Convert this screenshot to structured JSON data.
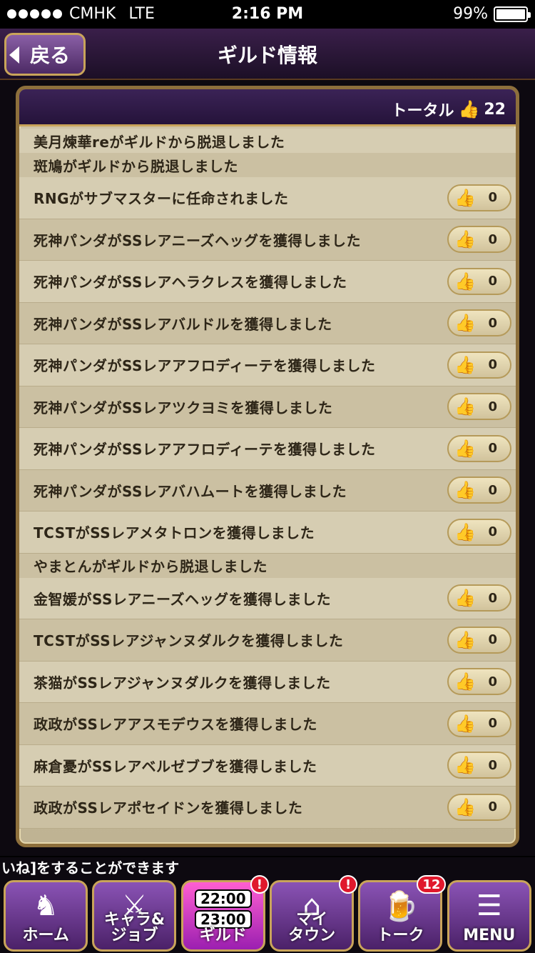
{
  "status_bar": {
    "carrier": "CMHK",
    "network": "LTE",
    "time": "2:16 PM",
    "battery": "99%",
    "battery_level": 0.99
  },
  "header": {
    "back_label": "戻る",
    "title": "ギルド情報"
  },
  "panel": {
    "total_label": "トータル",
    "total_icon": "thumbs-up-icon",
    "total_count": "22"
  },
  "feed": {
    "items": [
      {
        "text": "美月煉華reがギルドから脱退しました",
        "likeable": false,
        "count": ""
      },
      {
        "text": "斑鳩がギルドから脱退しました",
        "likeable": false,
        "count": ""
      },
      {
        "text": "RNGがサブマスターに任命されました",
        "likeable": true,
        "count": "0"
      },
      {
        "text": "死神パンダがSSレアニーズヘッグを獲得しました",
        "likeable": true,
        "count": "0"
      },
      {
        "text": "死神パンダがSSレアヘラクレスを獲得しました",
        "likeable": true,
        "count": "0"
      },
      {
        "text": "死神パンダがSSレアバルドルを獲得しました",
        "likeable": true,
        "count": "0"
      },
      {
        "text": "死神パンダがSSレアアフロディーテを獲得しました",
        "likeable": true,
        "count": "0"
      },
      {
        "text": "死神パンダがSSレアツクヨミを獲得しました",
        "likeable": true,
        "count": "0"
      },
      {
        "text": "死神パンダがSSレアアフロディーテを獲得しました",
        "likeable": true,
        "count": "0"
      },
      {
        "text": "死神パンダがSSレアバハムートを獲得しました",
        "likeable": true,
        "count": "0"
      },
      {
        "text": "TCSTがSSレアメタトロンを獲得しました",
        "likeable": true,
        "count": "0"
      },
      {
        "text": "やまとんがギルドから脱退しました",
        "likeable": false,
        "count": ""
      },
      {
        "text": "金智媛がSSレアニーズヘッグを獲得しました",
        "likeable": true,
        "count": "0"
      },
      {
        "text": "TCSTがSSレアジャンヌダルクを獲得しました",
        "likeable": true,
        "count": "0"
      },
      {
        "text": "茶猫がSSレアジャンヌダルクを獲得しました",
        "likeable": true,
        "count": "0"
      },
      {
        "text": "政政がSSレアアスモデウスを獲得しました",
        "likeable": true,
        "count": "0"
      },
      {
        "text": "麻倉憂がSSレアベルゼブブを獲得しました",
        "likeable": true,
        "count": "0"
      },
      {
        "text": "政政がSSレアポセイドンを獲得しました",
        "likeable": true,
        "count": "0"
      }
    ]
  },
  "ticker": {
    "text": "いね]をすることができます"
  },
  "nav": {
    "home": {
      "label": "ホーム",
      "icon": "knight-horse-icon"
    },
    "chara": {
      "label": "キャラ&\nジョブ",
      "icon": "character-icon"
    },
    "guild": {
      "label": "ギルド",
      "time1": "22:00",
      "time2": "23:00",
      "badge": "!"
    },
    "mytown": {
      "label": "マイ\nタウン",
      "icon": "town-icon",
      "badge": "!"
    },
    "talk": {
      "label": "トーク",
      "icon": "beer-mugs-icon",
      "badge": "12"
    },
    "menu": {
      "label": "MENU",
      "icon": "hamburger-icon"
    }
  }
}
